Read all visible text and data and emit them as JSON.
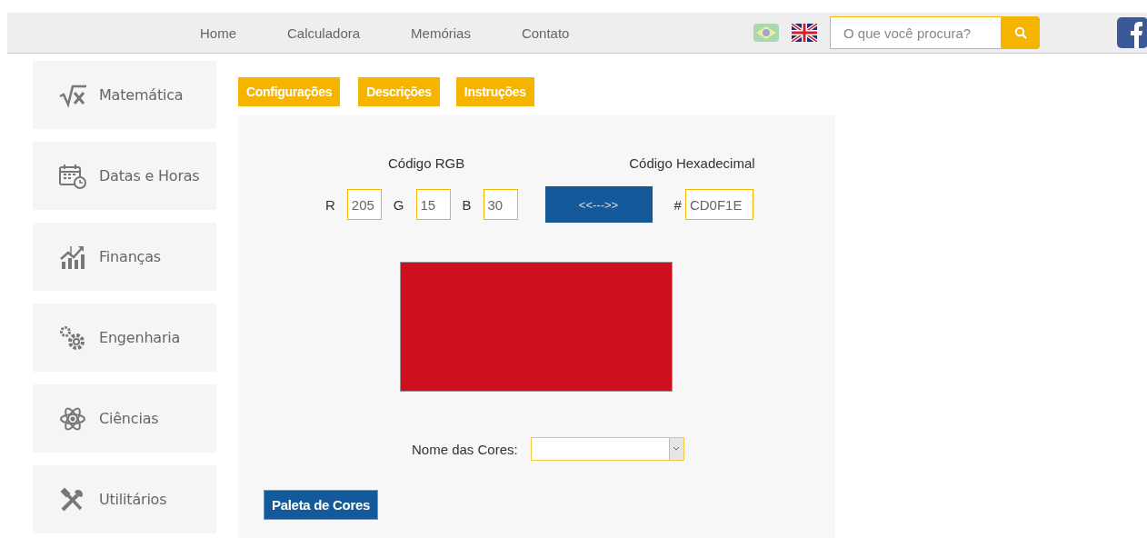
{
  "nav": {
    "links": [
      "Home",
      "Calculadora",
      "Memórias",
      "Contato"
    ],
    "search": {
      "placeholder": "O que você procura?"
    }
  },
  "sidebar": {
    "items": [
      "Matemática",
      "Datas e Horas",
      "Finanças",
      "Engenharia",
      "Ciências",
      "Utilitários"
    ]
  },
  "tabs": [
    "Configurações",
    "Descrições",
    "Instruções"
  ],
  "converter": {
    "rgb_title": "Código RGB",
    "hex_title": "Código Hexadecimal",
    "channels": [
      {
        "label": "R",
        "value": "205"
      },
      {
        "label": "G",
        "value": "15"
      },
      {
        "label": "B",
        "value": "30"
      }
    ],
    "convert_button": "<<--->>",
    "hex_label": "#",
    "hex_value": "CD0F1E"
  },
  "color_names": {
    "label": "Nome das Cores:"
  },
  "palette_button": "Paleta de Cores"
}
